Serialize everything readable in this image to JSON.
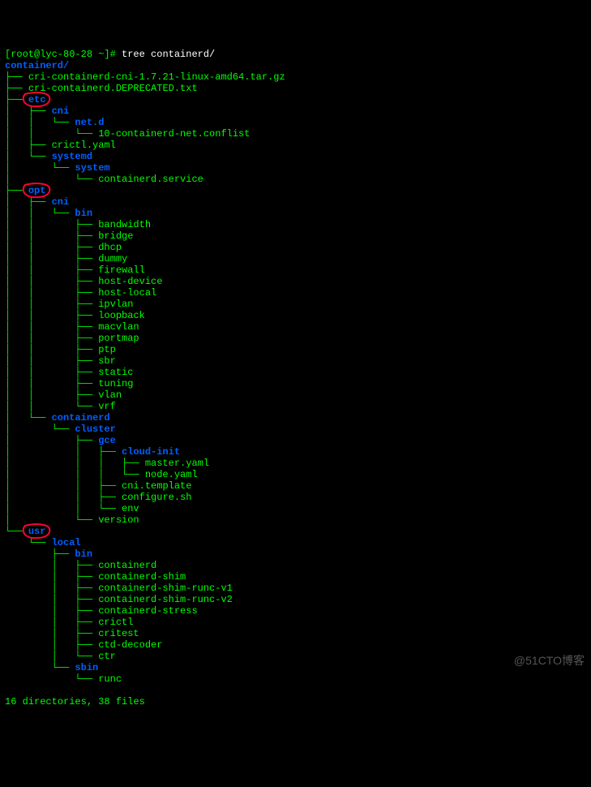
{
  "prompt": "[root@lyc-80-28 ~]# ",
  "command": "tree containerd/",
  "rootdir": "containerd/",
  "summary": "16 directories, 38 files",
  "watermark": "@51CTO博客",
  "nodes": [
    {
      "p": "├── ",
      "t": "cri-containerd-cni-1.7.21-linux-amd64.tar.gz",
      "d": false
    },
    {
      "p": "├── ",
      "t": "cri-containerd.DEPRECATED.txt",
      "d": false
    },
    {
      "p": "├── ",
      "t": "etc",
      "d": true,
      "hl": true
    },
    {
      "p": "│   ├── ",
      "t": "cni",
      "d": true
    },
    {
      "p": "│   │   └── ",
      "t": "net.d",
      "d": true
    },
    {
      "p": "│   │       └── ",
      "t": "10-containerd-net.conflist",
      "d": false
    },
    {
      "p": "│   ├── ",
      "t": "crictl.yaml",
      "d": false
    },
    {
      "p": "│   └── ",
      "t": "systemd",
      "d": true
    },
    {
      "p": "│       └── ",
      "t": "system",
      "d": true
    },
    {
      "p": "│           └── ",
      "t": "containerd.service",
      "d": false
    },
    {
      "p": "├── ",
      "t": "opt",
      "d": true,
      "hl": true
    },
    {
      "p": "│   ├── ",
      "t": "cni",
      "d": true
    },
    {
      "p": "│   │   └── ",
      "t": "bin",
      "d": true
    },
    {
      "p": "│   │       ├── ",
      "t": "bandwidth",
      "d": false
    },
    {
      "p": "│   │       ├── ",
      "t": "bridge",
      "d": false
    },
    {
      "p": "│   │       ├── ",
      "t": "dhcp",
      "d": false
    },
    {
      "p": "│   │       ├── ",
      "t": "dummy",
      "d": false
    },
    {
      "p": "│   │       ├── ",
      "t": "firewall",
      "d": false
    },
    {
      "p": "│   │       ├── ",
      "t": "host-device",
      "d": false
    },
    {
      "p": "│   │       ├── ",
      "t": "host-local",
      "d": false
    },
    {
      "p": "│   │       ├── ",
      "t": "ipvlan",
      "d": false
    },
    {
      "p": "│   │       ├── ",
      "t": "loopback",
      "d": false
    },
    {
      "p": "│   │       ├── ",
      "t": "macvlan",
      "d": false
    },
    {
      "p": "│   │       ├── ",
      "t": "portmap",
      "d": false
    },
    {
      "p": "│   │       ├── ",
      "t": "ptp",
      "d": false
    },
    {
      "p": "│   │       ├── ",
      "t": "sbr",
      "d": false
    },
    {
      "p": "│   │       ├── ",
      "t": "static",
      "d": false
    },
    {
      "p": "│   │       ├── ",
      "t": "tuning",
      "d": false
    },
    {
      "p": "│   │       ├── ",
      "t": "vlan",
      "d": false
    },
    {
      "p": "│   │       └── ",
      "t": "vrf",
      "d": false
    },
    {
      "p": "│   └── ",
      "t": "containerd",
      "d": true
    },
    {
      "p": "│       └── ",
      "t": "cluster",
      "d": true
    },
    {
      "p": "│           ├── ",
      "t": "gce",
      "d": true
    },
    {
      "p": "│           │   ├── ",
      "t": "cloud-init",
      "d": true
    },
    {
      "p": "│           │   │   ├── ",
      "t": "master.yaml",
      "d": false
    },
    {
      "p": "│           │   │   └── ",
      "t": "node.yaml",
      "d": false
    },
    {
      "p": "│           │   ├── ",
      "t": "cni.template",
      "d": false
    },
    {
      "p": "│           │   ├── ",
      "t": "configure.sh",
      "d": false
    },
    {
      "p": "│           │   └── ",
      "t": "env",
      "d": false
    },
    {
      "p": "│           └── ",
      "t": "version",
      "d": false
    },
    {
      "p": "└── ",
      "t": "usr",
      "d": true,
      "hl": true
    },
    {
      "p": "    └── ",
      "t": "local",
      "d": true
    },
    {
      "p": "        ├── ",
      "t": "bin",
      "d": true
    },
    {
      "p": "        │   ├── ",
      "t": "containerd",
      "d": false
    },
    {
      "p": "        │   ├── ",
      "t": "containerd-shim",
      "d": false
    },
    {
      "p": "        │   ├── ",
      "t": "containerd-shim-runc-v1",
      "d": false
    },
    {
      "p": "        │   ├── ",
      "t": "containerd-shim-runc-v2",
      "d": false
    },
    {
      "p": "        │   ├── ",
      "t": "containerd-stress",
      "d": false
    },
    {
      "p": "        │   ├── ",
      "t": "crictl",
      "d": false
    },
    {
      "p": "        │   ├── ",
      "t": "critest",
      "d": false
    },
    {
      "p": "        │   ├── ",
      "t": "ctd-decoder",
      "d": false
    },
    {
      "p": "        │   └── ",
      "t": "ctr",
      "d": false
    },
    {
      "p": "        └── ",
      "t": "sbin",
      "d": true
    },
    {
      "p": "            └── ",
      "t": "runc",
      "d": false
    }
  ]
}
